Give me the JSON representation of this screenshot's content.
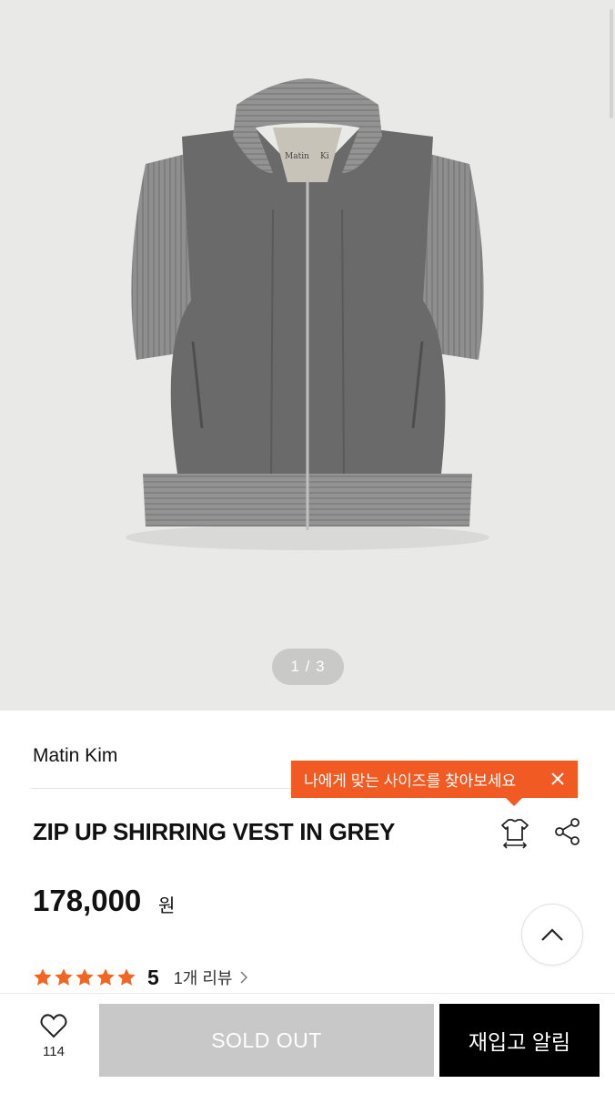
{
  "gallery": {
    "pager_text": "1 / 3",
    "image_alt": "grey wool zip up vest",
    "label_left": "Matin",
    "label_right": "Ki"
  },
  "product": {
    "brand": "Matin Kim",
    "name": "ZIP UP SHIRRING VEST IN GREY",
    "price": "178,000",
    "currency": "원",
    "rating_score": "5",
    "rating_stars": 5,
    "review_link": "1개 리뷰"
  },
  "tooltip": {
    "text": "나에게 맞는 사이즈를 찾아보세요"
  },
  "bottom_bar": {
    "like_count": "114",
    "sold_out_label": "SOLD OUT",
    "restock_label": "재입고 알림"
  },
  "colors": {
    "accent": "#f15a22",
    "star": "#f26522",
    "sold_out_bg": "#c8c8c8",
    "restock_bg": "#000000"
  },
  "icons": [
    "size-guide-icon",
    "share-icon",
    "chevron-up-icon",
    "heart-icon",
    "close-icon",
    "chevron-right-icon",
    "star-icon"
  ]
}
